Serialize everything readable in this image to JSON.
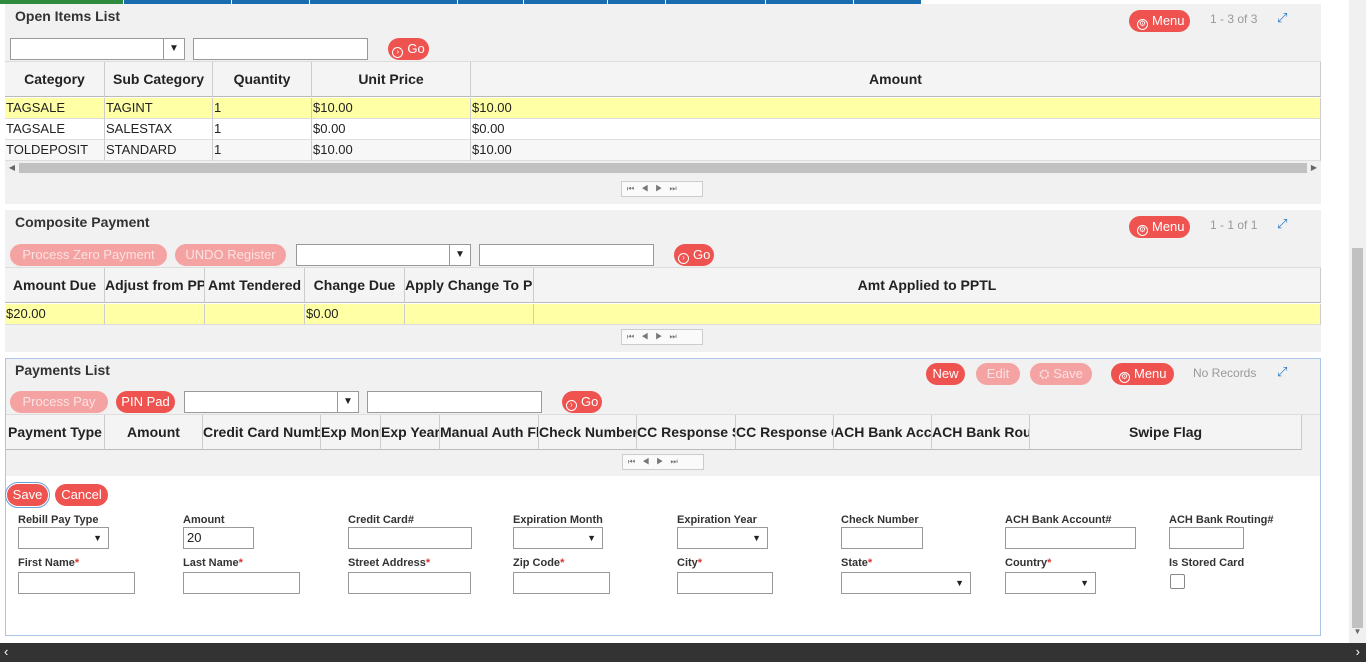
{
  "open_items": {
    "title": "Open Items List",
    "menu_label": "Menu",
    "pager_info": "1 - 3 of 3",
    "go_label": "Go",
    "columns": [
      "Category",
      "Sub Category",
      "Quantity",
      "Unit Price",
      "Amount"
    ],
    "rows": [
      [
        "TAGSALE",
        "TAGINT",
        "1",
        "$10.00",
        "$10.00"
      ],
      [
        "TAGSALE",
        "SALESTAX",
        "1",
        "$0.00",
        "$0.00"
      ],
      [
        "TOLDEPOSIT",
        "STANDARD",
        "1",
        "$10.00",
        "$10.00"
      ]
    ]
  },
  "composite_payment": {
    "title": "Composite Payment",
    "menu_label": "Menu",
    "pager_info": "1 - 1 of 1",
    "process_zero_label": "Process Zero Payment",
    "undo_label": "UNDO Register",
    "go_label": "Go",
    "columns": [
      "Amount Due",
      "Adjust from PPT",
      "Amt Tendered",
      "Change Due",
      "Apply Change To PPT",
      "Amt Applied to PPTL"
    ],
    "rows": [
      [
        "$20.00",
        "",
        "",
        "$0.00",
        "",
        ""
      ]
    ]
  },
  "payments_list": {
    "title": "Payments List",
    "new_label": "New",
    "edit_label": "Edit",
    "save_label": "Save",
    "menu_label": "Menu",
    "pager_info": "No Records",
    "process_pay_label": "Process Pay",
    "pin_pad_label": "PIN Pad",
    "go_label": "Go",
    "columns": [
      "Payment Type",
      "Amount",
      "Credit Card Number",
      "Exp Month",
      "Exp Year",
      "Manual Auth Flag",
      "Check Number",
      "CC Response Status",
      "CC Response Code",
      "ACH Bank Account",
      "ACH Bank Routing",
      "Swipe Flag"
    ]
  },
  "form": {
    "save_label": "Save",
    "cancel_label": "Cancel",
    "fields": {
      "rebill_pay_type": "Rebill Pay Type",
      "amount": "Amount",
      "amount_value": "20",
      "credit_card": "Credit Card#",
      "expiration_month": "Expiration Month",
      "expiration_year": "Expiration Year",
      "check_number": "Check Number",
      "ach_bank_account": "ACH Bank Account#",
      "ach_bank_routing": "ACH Bank Routing#",
      "first_name": "First Name",
      "last_name": "Last Name",
      "street_address": "Street Address",
      "zip_code": "Zip Code",
      "city": "City",
      "state": "State",
      "country": "Country",
      "is_stored_card": "Is Stored Card",
      "required_mark": "*"
    }
  },
  "colors": {
    "accent": "#ef5350",
    "selected_row": "#ffffa6",
    "tab_bar": "#1a6bb0"
  }
}
